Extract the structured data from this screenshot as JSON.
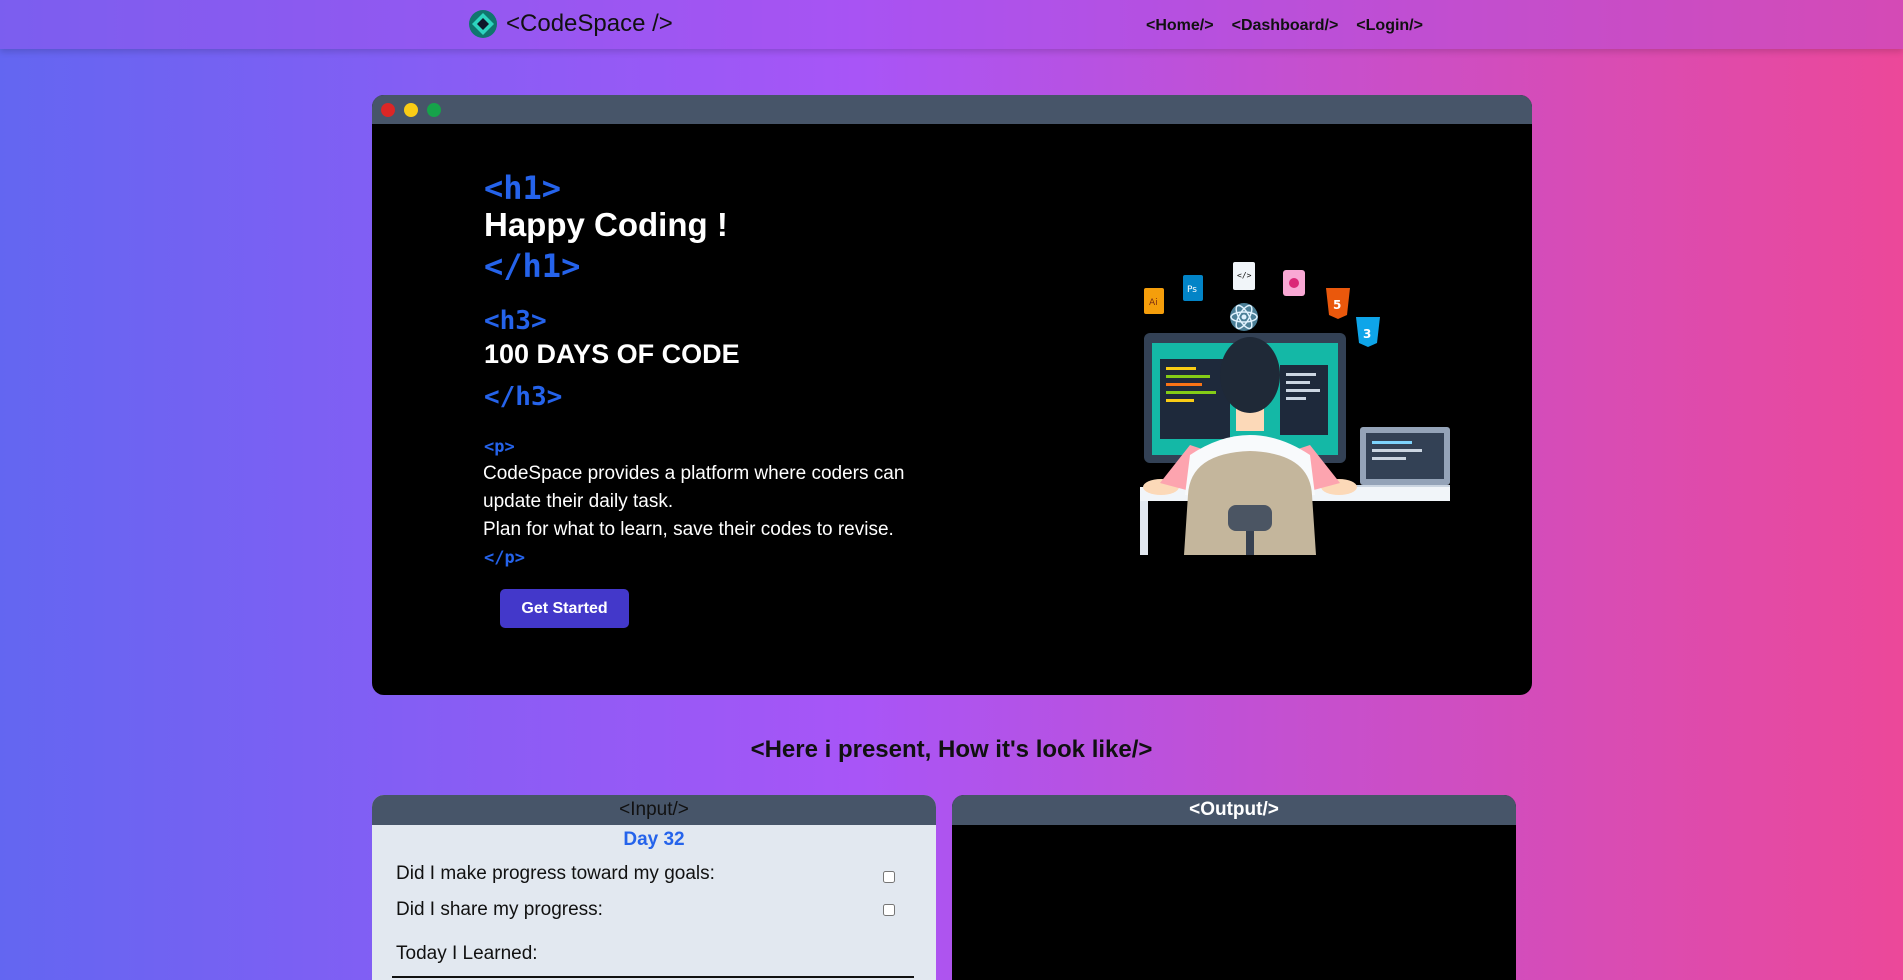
{
  "nav": {
    "brand": "<CodeSpace />",
    "links": [
      "<Home/>",
      "<Dashboard/>",
      "<Login/>"
    ]
  },
  "hero": {
    "h1_open": "<h1>",
    "h1_text": "Happy Coding !",
    "h1_close": "</h1>",
    "h3_open": "<h3>",
    "h3_text": "100 DAYS OF CODE",
    "h3_close": "</h3>",
    "p_open": "<p>",
    "p_line1": "CodeSpace provides a platform where coders can",
    "p_line2": "update their daily task.",
    "p_line3": "Plan for what to learn, save their codes to revise.",
    "p_close": "</p>",
    "cta": "Get Started"
  },
  "section": {
    "title": "<Here i present, How it's look like/>"
  },
  "input_panel": {
    "title": "<Input/>",
    "day": "Day 32",
    "questions": [
      "Did I make progress toward my goals:",
      "Did I share my progress:"
    ],
    "learned_label": "Today I Learned:"
  },
  "output_panel": {
    "title": "<Output/>"
  },
  "colors": {
    "accent": "#2563eb",
    "button": "#4338ca",
    "window_bar": "#475569"
  }
}
